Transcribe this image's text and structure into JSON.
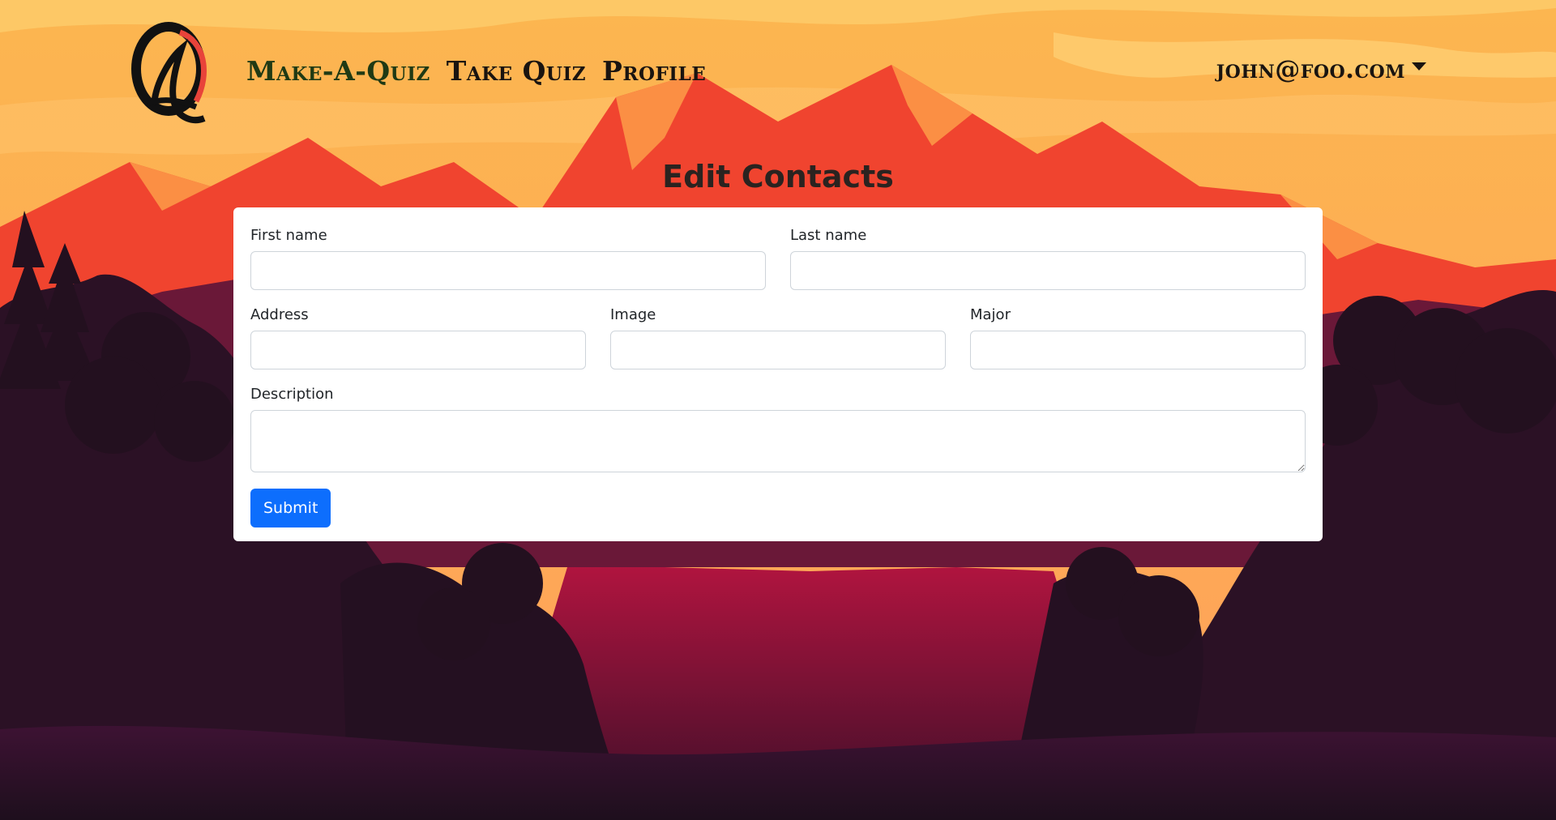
{
  "nav": {
    "links": [
      "Make-A-Quiz",
      "Take Quiz",
      "Profile"
    ],
    "user_email": "john@foo.com"
  },
  "page_title": "Edit Contacts",
  "form": {
    "first_name_label": "First name",
    "first_name_value": "",
    "last_name_label": "Last name",
    "last_name_value": "",
    "address_label": "Address",
    "address_value": "",
    "image_label": "Image",
    "image_value": "",
    "major_label": "Major",
    "major_value": "",
    "description_label": "Description",
    "description_value": "",
    "submit_label": "Submit"
  },
  "icons": {
    "logo": "quiz-logo-icon",
    "dropdown": "caret-down-icon"
  },
  "colors": {
    "sky": "#fdb95b",
    "mountain": "#f5412f",
    "forest": "#2b1125",
    "lake": "#a0123e",
    "button": "#0d6efd"
  }
}
